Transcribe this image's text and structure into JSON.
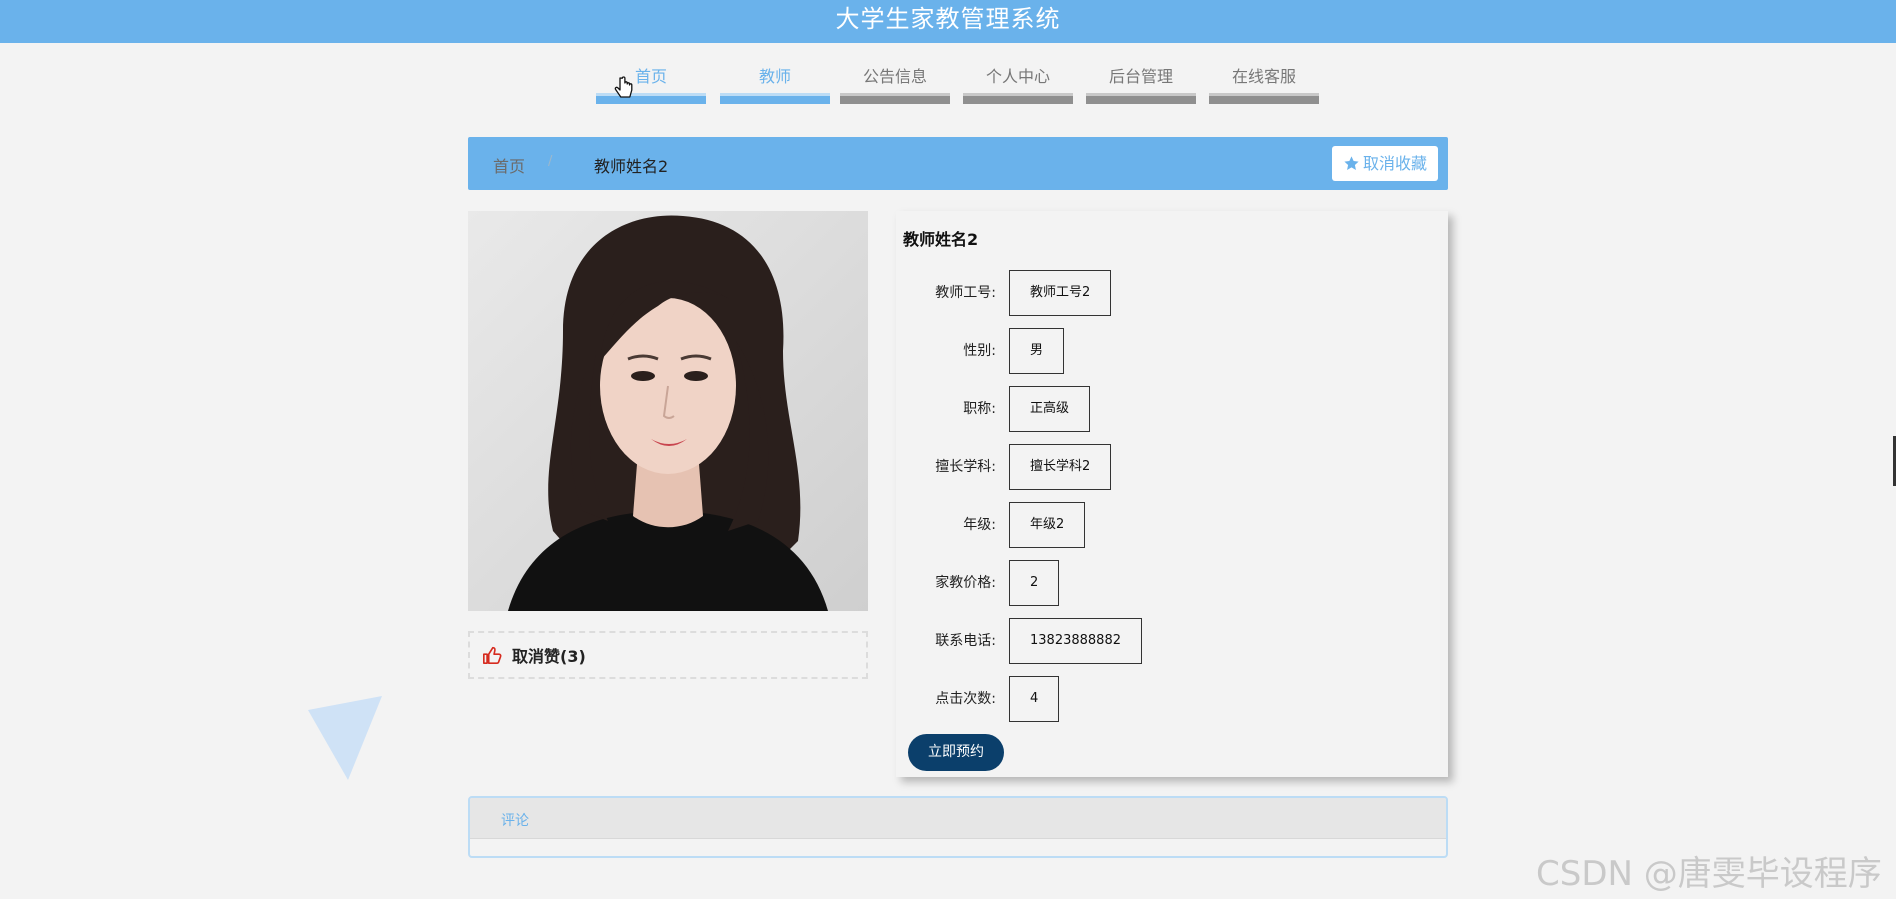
{
  "app": {
    "title": "大学生家教管理系统"
  },
  "nav": {
    "items": [
      {
        "label": "首页"
      },
      {
        "label": "教师"
      },
      {
        "label": "公告信息"
      },
      {
        "label": "个人中心"
      },
      {
        "label": "后台管理"
      },
      {
        "label": "在线客服"
      }
    ]
  },
  "breadcrumb": {
    "home": "首页",
    "separator": "/",
    "current": "教师姓名2",
    "fav_label": "取消收藏"
  },
  "like": {
    "label": "取消赞(3)"
  },
  "teacher": {
    "name": "教师姓名2",
    "fields": [
      {
        "key": "教师工号:",
        "value": "教师工号2"
      },
      {
        "key": "性别:",
        "value": "男"
      },
      {
        "key": "职称:",
        "value": "正高级"
      },
      {
        "key": "擅长学科:",
        "value": "擅长学科2"
      },
      {
        "key": "年级:",
        "value": "年级2"
      },
      {
        "key": "家教价格:",
        "value": "2"
      },
      {
        "key": "联系电话:",
        "value": "13823888882"
      },
      {
        "key": "点击次数:",
        "value": "4"
      }
    ],
    "book_label": "立即预约"
  },
  "comments": {
    "tab_label": "评论"
  },
  "watermark": "CSDN @唐雯毕设程序",
  "colors": {
    "primary": "#6ab2eb",
    "dark_button": "#0b3f6b",
    "like_icon": "#d62b1f"
  }
}
